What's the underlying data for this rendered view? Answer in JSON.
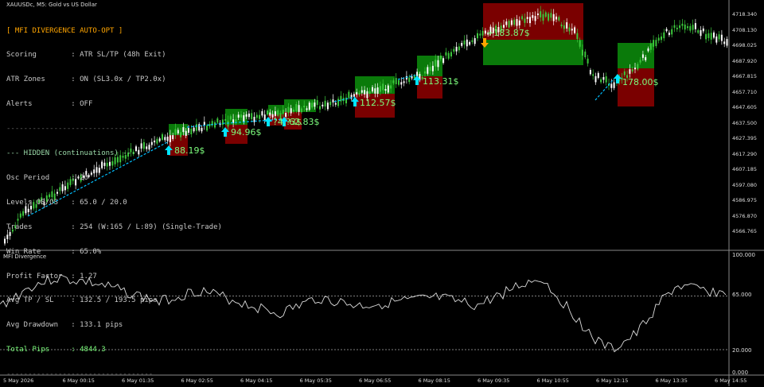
{
  "symbol": "XAUUSDc, M5:  Gold vs US Dollar",
  "panel": {
    "title": "[ MFI DIVERGENCE AUTO-OPT ]",
    "scoring": "Scoring        : ATR SL/TP (48h Exit)",
    "atr_zones": "ATR Zones      : ON (SL3.0x / TP2.0x)",
    "alerts": "Alerts         : OFF",
    "sep1": "----------------------------------",
    "hidden_header": "--- HIDDEN (continuations) ---",
    "osc_period": "Osc Period     : 20",
    "levels": "Levels OB/OS   : 65.0 / 20.0",
    "trades": "Trades         : 254 (W:165 / L:89) (Single-Trade)",
    "win_rate": "Win Rate       : 65.0%",
    "profit_factor": "Profit Factor  : 1.27",
    "avg_tp_sl": "Avg TP / SL    : 132.5 / 193.5 pips",
    "avg_dd": "Avg Drawdown   : 133.1 pips",
    "total_pips": "Total Pips     : 4844.3",
    "sep2": "----------------------------------"
  },
  "price_axis": [
    "4718.340",
    "4708.130",
    "4698.025",
    "4687.920",
    "4667.815",
    "4657.710",
    "4647.605",
    "4637.500",
    "4627.395",
    "4617.290",
    "4607.185",
    "4597.080",
    "4586.975",
    "4576.870",
    "4566.765"
  ],
  "indicator": {
    "label": "MFI Divergence",
    "ticks": [
      "100.000",
      "65.000",
      "20.000",
      "0.000"
    ],
    "levels": [
      65,
      20
    ]
  },
  "time_axis": [
    "5 May 2026",
    "6 May 00:15",
    "6 May 01:35",
    "6 May 02:55",
    "6 May 04:15",
    "6 May 05:35",
    "6 May 06:55",
    "6 May 08:15",
    "6 May 09:35",
    "6 May 10:55",
    "6 May 12:15",
    "6 May 13:35",
    "6 May 14:55"
  ],
  "trades": [
    {
      "label": "88.19$"
    },
    {
      "label": "94.96$"
    },
    {
      "label": "?4.?3$"
    },
    {
      "label": "62.83$"
    },
    {
      "label": "112.57$"
    },
    {
      "label": "113.31$"
    },
    {
      "label": "+183.87$"
    },
    {
      "label": "178.00$"
    }
  ],
  "colors": {
    "background": "#000000",
    "candle_up": "#3cc83c",
    "candle_down": "#ffffff",
    "tp_zone": "#0a7a0a",
    "sl_zone": "#7a0000",
    "arrow_buy": "#00e5ff",
    "arrow_sell": "#ffa500",
    "divergence_line": "#00bfff"
  }
}
